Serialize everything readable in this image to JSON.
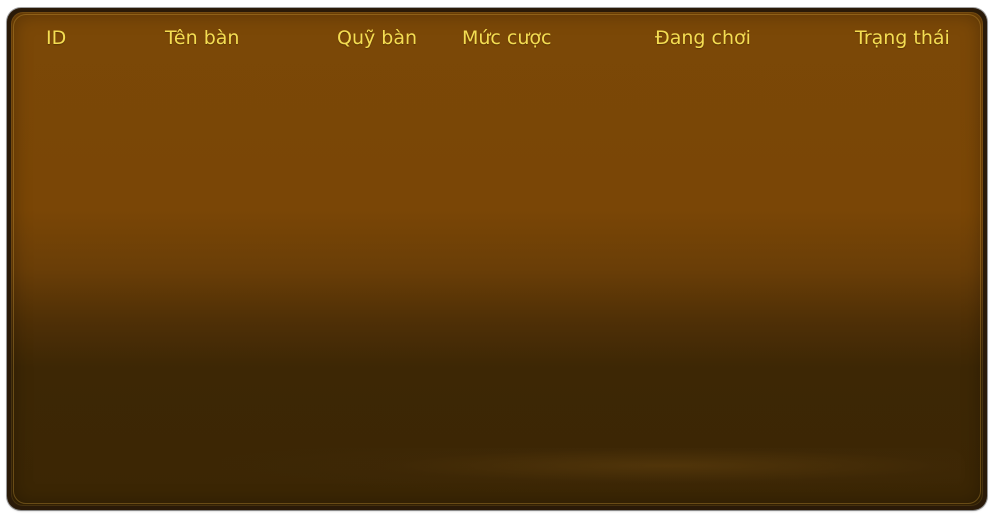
{
  "table": {
    "headers": {
      "id": "ID",
      "name": "Tên bàn",
      "fund": "Quỹ bàn",
      "bet": "Mức cược",
      "playing": "Đang chơi",
      "status": "Trạng thái"
    },
    "rows": []
  },
  "colors": {
    "header_text": "#f4dd52",
    "panel_top": "#7b4807",
    "panel_bottom": "#3b2604"
  }
}
